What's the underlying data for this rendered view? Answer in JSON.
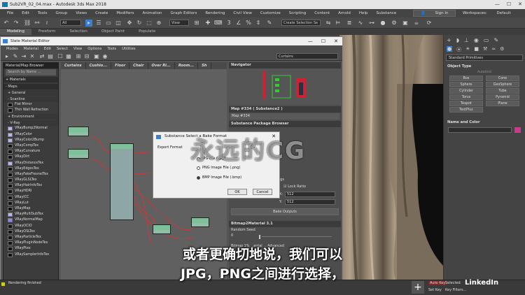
{
  "app": {
    "title": "Sub2VR_02_04.max - Autodesk 3ds Max 2018"
  },
  "menubar": [
    "File",
    "Edit",
    "Tools",
    "Group",
    "Views",
    "Create",
    "Modifiers",
    "Animation",
    "Graph Editors",
    "Rendering",
    "Civil View",
    "Customize",
    "Scripting",
    "Content",
    "Arnold",
    "Help",
    "Substance"
  ],
  "signin": "Sign In",
  "workspace_label": "Workspaces:",
  "workspace_value": "Default",
  "toolbar": {
    "selection_filter": "All",
    "view_dropdown": "View",
    "create_selection_set": "Create Selection Se"
  },
  "ribbon": {
    "tabs": [
      "Modeling",
      "Freeform",
      "Selection",
      "Object Paint",
      "Populate"
    ]
  },
  "sme": {
    "title": "Slate Material Editor",
    "menu": [
      "Modes",
      "Material",
      "Edit",
      "Select",
      "View",
      "Options",
      "Tools",
      "Utilities"
    ],
    "view_dropdown": "Curtains",
    "browser_title": "Material/Map Browser",
    "search_placeholder": "Search by Name ...",
    "categories": {
      "materials": "+ Materials",
      "maps": "- Maps",
      "general": "+ General",
      "scanline": "- Scanline",
      "environment": "+ Environment",
      "vray": "- V-Ray"
    },
    "scanline_items": [
      "Flat Mirror",
      "Thin Wall Refraction"
    ],
    "vray_items": [
      "VRayBump2Normal",
      "VRayColor",
      "VRayColor2Bump",
      "VRayCompTex",
      "VRayCurvature",
      "VRayDirt",
      "VRayDistanceTex",
      "VRayEdgesTex",
      "VRayFakeFresnelTex",
      "VRayGLSLTex",
      "VRayHairInfoTex",
      "VRayHDRI",
      "VRayICC",
      "VRayLut",
      "VRayMap",
      "VRayMultiSubTex",
      "VRayNormalMap",
      "VRayOCIO",
      "VRayOSLTex",
      "VRayParticleTex",
      "VRayPluginNodeTex",
      "VRayPtex",
      "VRaySamplerInfoTex"
    ],
    "view_tabs": [
      "Curtains",
      "Cushio...",
      "Floor",
      "Chair",
      "Over Ri...",
      "Room...",
      "Sh"
    ],
    "navigator": "Navigator",
    "map_header": "Map #334  ( Substance2 )",
    "map_name": "Map #334",
    "rollouts": {
      "package_browser": "Substance Package Browser",
      "bitmap_rollout": "Bitmap2Material 3.1",
      "random_seed": "Random Seed"
    },
    "bake": {
      "lock_ratio": "Lock Ratio",
      "width": "512",
      "height": "512",
      "bake_outputs": "Bake Outputs",
      "x_label": "X:",
      "y_label": "Y:",
      "ngs": "ngs"
    },
    "random_seed_value": "0",
    "bitmap_line": "Bitmap  1%  ...ental ... Advanced"
  },
  "dialog": {
    "title": "Substance Select a Bake Format",
    "label": "Export Format",
    "options": [
      "JPG File (.jpg)",
      "PNG Image File (.png)",
      "BMP Image File (.bmp)"
    ],
    "selected": 2,
    "ok": "OK",
    "cancel": "Cancel"
  },
  "cmdpanel": {
    "dropdown": "Standard Primitives",
    "object_type_header": "Object Type",
    "autogrid": "AutoGrid",
    "buttons": [
      "Box",
      "Cone",
      "Sphere",
      "GeoSphere",
      "Cylinder",
      "Tube",
      "Torus",
      "Pyramid",
      "Teapot",
      "Plane",
      "TextPlus"
    ],
    "name_color_header": "Name and Color",
    "accent": "#cc3a8e"
  },
  "status": {
    "rendering": "Rendering finished",
    "add_time_tag": "Auto Key",
    "set_key": "Set Key",
    "key_filters": "Key Filters...",
    "selected": "Selected"
  },
  "watermark": "永远的CG",
  "subtitle_lines": [
    "或者更确切地说，我们可以",
    "JPG，PNG之间进行选择，"
  ],
  "brand": "LinkedIn"
}
